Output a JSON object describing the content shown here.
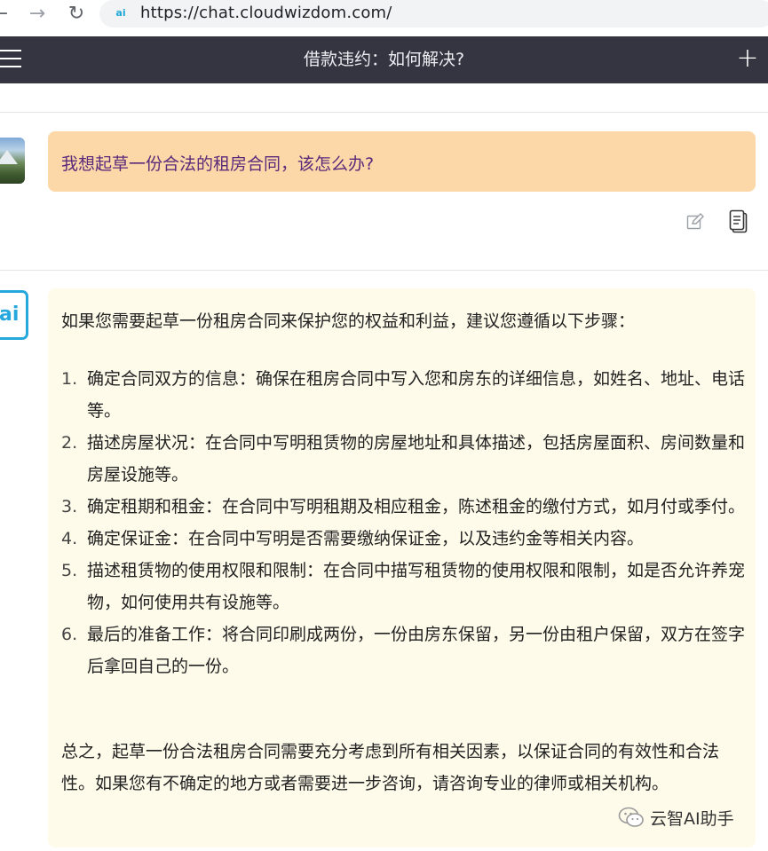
{
  "browser": {
    "url": "https://chat.cloudwizdom.com/",
    "site_icon_text": "ai"
  },
  "header": {
    "title": "借款违约：如何解决?"
  },
  "user_message": {
    "text": "我想起草一份合法的租房合同，该怎么办?"
  },
  "assistant_avatar_text": "ai",
  "assistant_message": {
    "intro": "如果您需要起草一份租房合同来保护您的权益和利益，建议您遵循以下步骤：",
    "steps": [
      {
        "num": "1.",
        "text": "确定合同双方的信息：确保在租房合同中写入您和房东的详细信息，如姓名、地址、电话等。"
      },
      {
        "num": "2.",
        "text": "描述房屋状况：在合同中写明租赁物的房屋地址和具体描述，包括房屋面积、房间数量和房屋设施等。"
      },
      {
        "num": "3.",
        "text": "确定租期和租金：在合同中写明租期及相应租金，陈述租金的缴付方式，如月付或季付。"
      },
      {
        "num": "4.",
        "text": "确定保证金：在合同中写明是否需要缴纳保证金，以及违约金等相关内容。"
      },
      {
        "num": "5.",
        "text": "描述租赁物的使用权限和限制：在合同中描写租赁物的使用权限和限制，如是否允许养宠物，如何使用共有设施等。"
      },
      {
        "num": "6.",
        "text": "最后的准备工作：将合同印刷成两份，一份由房东保留，另一份由租户保留，双方在签字后拿回自己的一份。"
      }
    ],
    "summary": "总之，起草一份合法租房合同需要充分考虑到所有相关因素，以保证合同的有效性和合法性。如果您有不确定的地方或者需要进一步咨询，请咨询专业的律师或相关机构。"
  },
  "watermark": {
    "text": "云智AI助手"
  },
  "colors": {
    "header_bg": "#343541",
    "user_bubble": "#fcd8a8",
    "assistant_bubble": "#fffbea",
    "accent": "#26a8dc"
  }
}
